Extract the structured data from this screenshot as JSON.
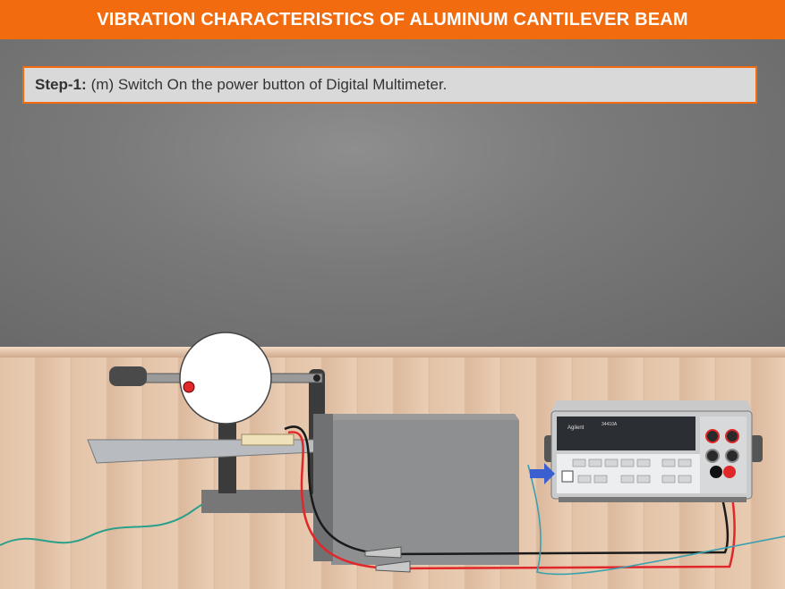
{
  "header": {
    "title": "VIBRATION CHARACTERISTICS OF ALUMINUM CANTILEVER BEAM"
  },
  "step": {
    "label": "Step-1:",
    "text": "(m) Switch On the power button of Digital Multimeter."
  },
  "multimeter": {
    "brand": "Agilent",
    "model": "34410A"
  },
  "colors": {
    "header": "#f26b0f",
    "step_border": "#f26b0f",
    "lead_red": "#e0282b",
    "lead_black": "#1a1a1a",
    "pointer": "#3a5fd0"
  }
}
